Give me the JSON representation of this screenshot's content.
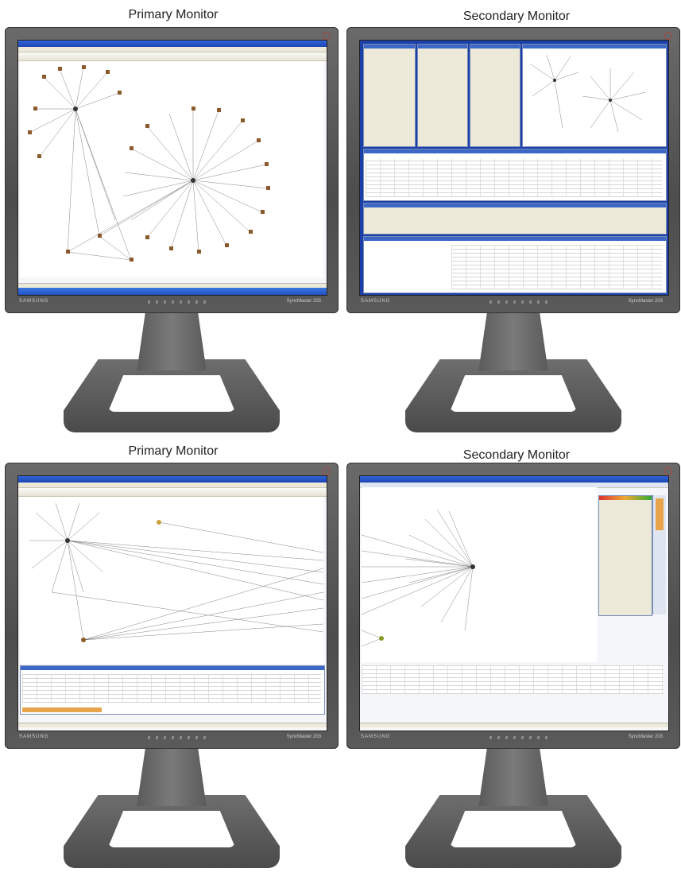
{
  "captions": {
    "top_left": "Primary Monitor",
    "top_right": "Secondary Monitor",
    "bottom_left": "Primary Monitor",
    "bottom_right": "Secondary Monitor"
  },
  "monitor": {
    "brand": "SAMSUNG",
    "model": "SyncMaster 203"
  },
  "colors": {
    "bezel": "#5a5a5a",
    "titlebar": "#1e46b5",
    "link_lines": "#555555",
    "label_blue": "#3355cc"
  }
}
